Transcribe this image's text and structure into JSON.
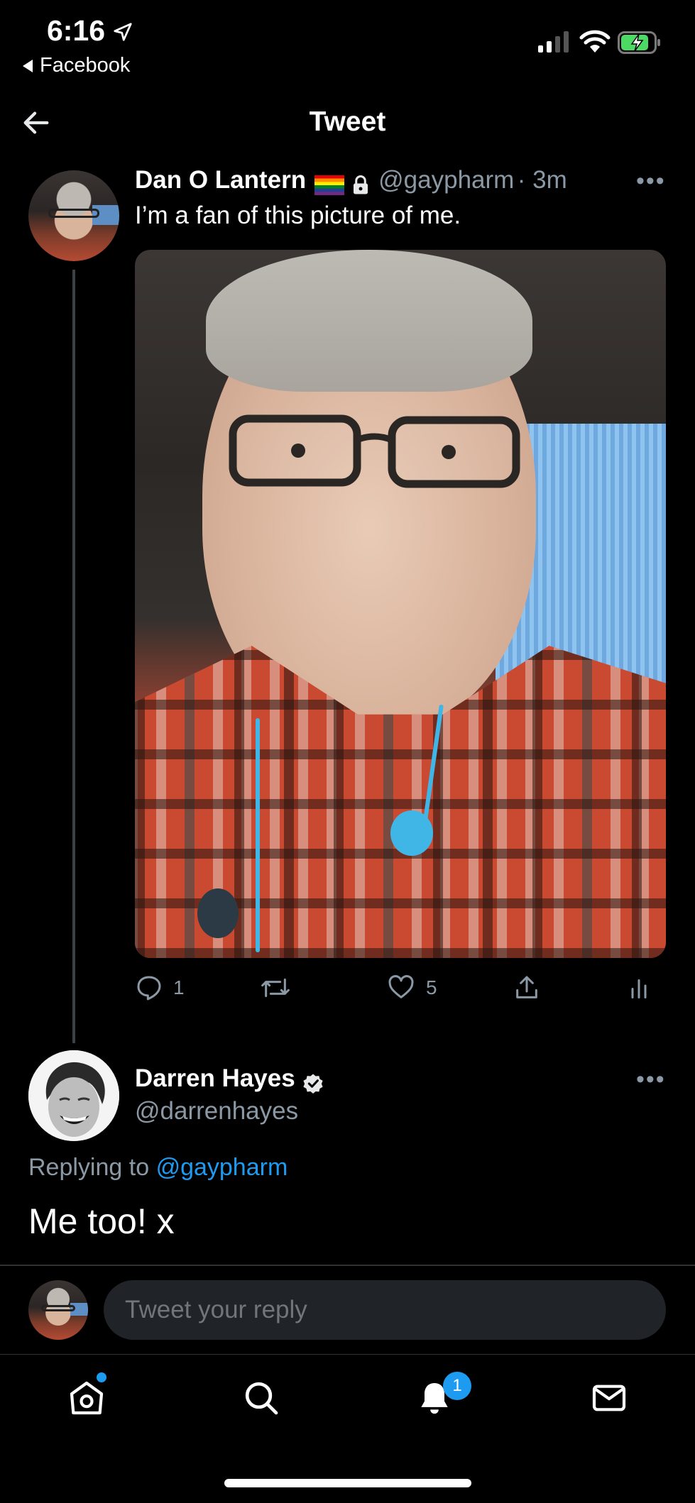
{
  "status_bar": {
    "time": "6:16",
    "back_app_label": "Facebook",
    "icons": [
      "location-arrow-icon",
      "cellular-signal-icon",
      "wifi-icon",
      "battery-charging-icon"
    ]
  },
  "header": {
    "title": "Tweet"
  },
  "tweet": {
    "author_name": "Dan O Lantern",
    "handle": "@gaypharm",
    "time_ago": "· 3m",
    "text": "I’m a fan of this picture of me.",
    "replies": "1",
    "likes": "5"
  },
  "reply": {
    "author_name": "Darren Hayes",
    "handle": "@darrenhayes",
    "replying_prefix": "Replying to",
    "replying_mention": "@gaypharm",
    "text": "Me too! x"
  },
  "compose": {
    "placeholder": "Tweet your reply"
  },
  "tab_bar": {
    "notifications_badge": "1",
    "tabs": [
      "home-icon",
      "search-icon",
      "notifications-icon",
      "messages-icon"
    ]
  },
  "colors": {
    "accent": "#1d9bf0",
    "background": "#000000",
    "secondary_text": "#8b98a5"
  }
}
